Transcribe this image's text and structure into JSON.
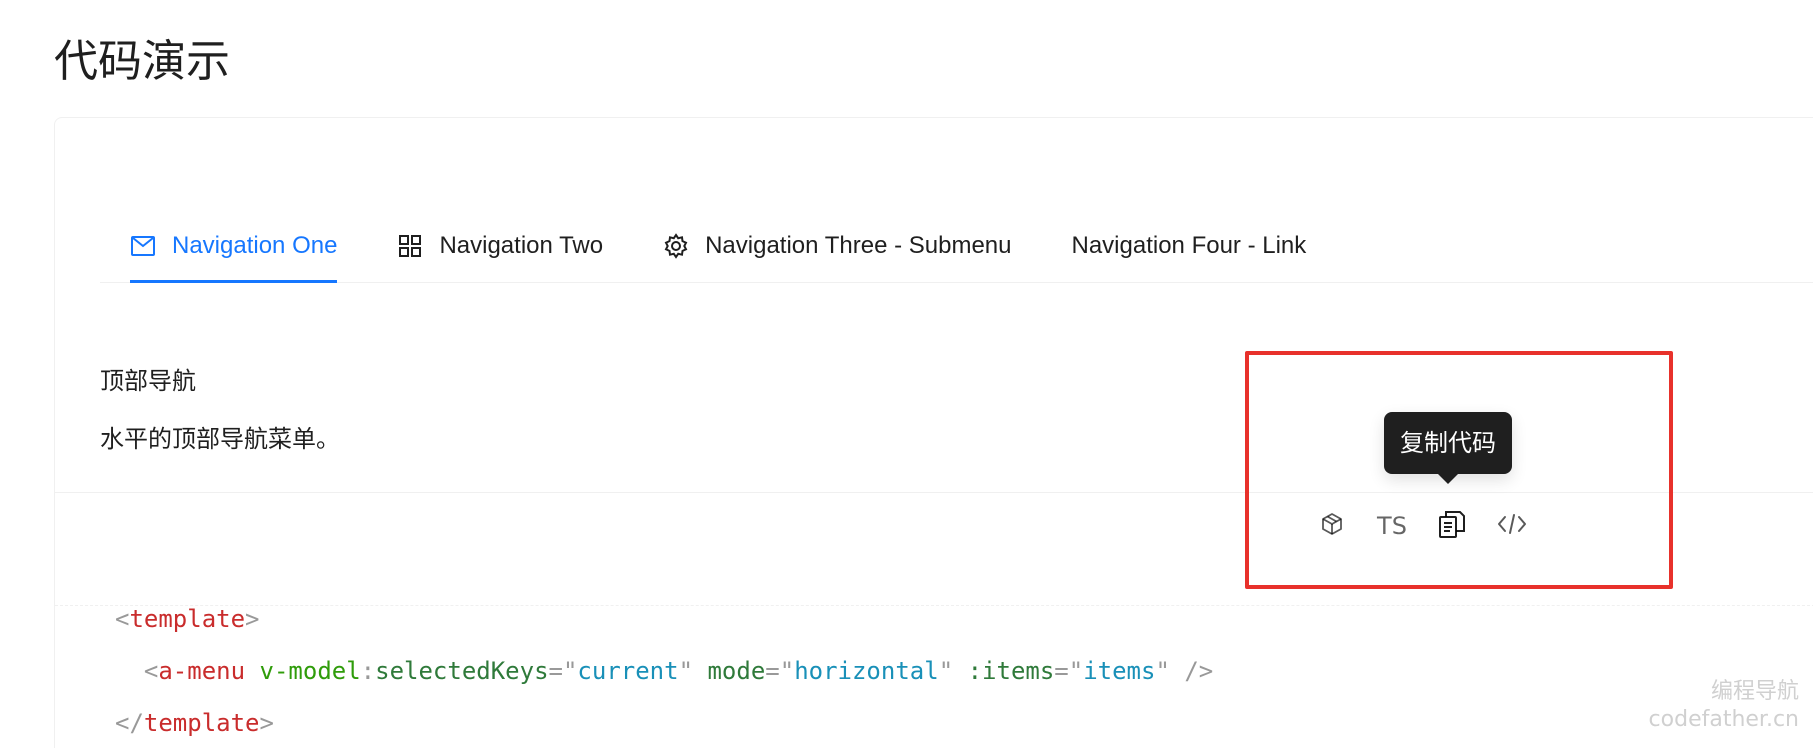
{
  "page": {
    "title": "代码演示"
  },
  "menu": {
    "items": [
      {
        "label": "Navigation One",
        "icon": "mail-icon",
        "active": true
      },
      {
        "label": "Navigation Two",
        "icon": "appstore-icon",
        "active": false
      },
      {
        "label": "Navigation Three - Submenu",
        "icon": "setting-icon",
        "active": false
      },
      {
        "label": "Navigation Four - Link",
        "icon": "",
        "active": false
      }
    ]
  },
  "meta": {
    "title": "顶部导航",
    "description": "水平的顶部导航菜单。"
  },
  "actions": {
    "codesandbox_icon": "codesandbox-icon",
    "ts_label": "TS",
    "copy_icon": "copy-icon",
    "expand_code_icon": "code-icon",
    "tooltip": "复制代码"
  },
  "code": {
    "line1": {
      "lt": "<",
      "tag": "template",
      "gt": ">"
    },
    "line2": {
      "lt": "<",
      "tag": "a-menu",
      "attr1_name": "v-model",
      "attr1_colon": ":",
      "attr1_arg": "selectedKeys",
      "eq1": "=",
      "q": "\"",
      "val1": "current",
      "attr2_name": "mode",
      "eq2": "=",
      "val2": "horizontal",
      "attr3_name": ":items",
      "eq3": "=",
      "val3": "items",
      "close": "/>"
    },
    "line3": {
      "lt": "</",
      "tag": "template",
      "gt": ">"
    }
  },
  "highlight": {
    "color": "#e8312b"
  },
  "colors": {
    "accent": "#1677ff"
  },
  "watermark": {
    "line1": "编程导航",
    "line2": "codefather.cn"
  }
}
